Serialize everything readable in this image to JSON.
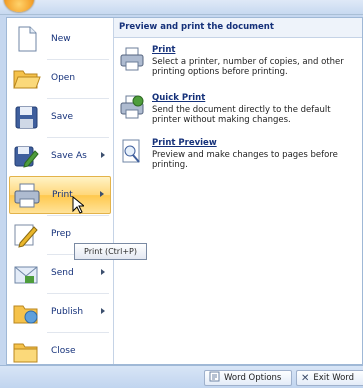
{
  "menu": {
    "items": [
      {
        "label": "New",
        "icon": "new-document-icon"
      },
      {
        "label": "Open",
        "icon": "open-folder-icon"
      },
      {
        "label": "Save",
        "icon": "save-disk-icon"
      },
      {
        "label": "Save As",
        "icon": "save-as-icon"
      },
      {
        "label": "Print",
        "icon": "printer-icon"
      },
      {
        "label": "Prep",
        "icon": "prepare-pencil-icon"
      },
      {
        "label": "Send",
        "icon": "send-icon"
      },
      {
        "label": "Publish",
        "icon": "publish-icon"
      },
      {
        "label": "Close",
        "icon": "close-folder-icon"
      }
    ]
  },
  "submenu": {
    "header": "Preview and print the document",
    "items": [
      {
        "title": "Print",
        "description": "Select a printer, number of copies, and other printing options before printing.",
        "icon": "printer-icon"
      },
      {
        "title": "Quick Print",
        "description": "Send the document directly to the default printer without making changes.",
        "icon": "quick-print-icon"
      },
      {
        "title": "Print Preview",
        "description": "Preview and make changes to pages before printing.",
        "icon": "print-preview-icon"
      }
    ]
  },
  "tooltip": "Print (Ctrl+P)",
  "footer": {
    "word_options": "Word Options",
    "exit_word": "Exit Word"
  },
  "colors": {
    "accent": "#ffc84d",
    "text": "#15317a",
    "frame": "#c5d7ef"
  }
}
